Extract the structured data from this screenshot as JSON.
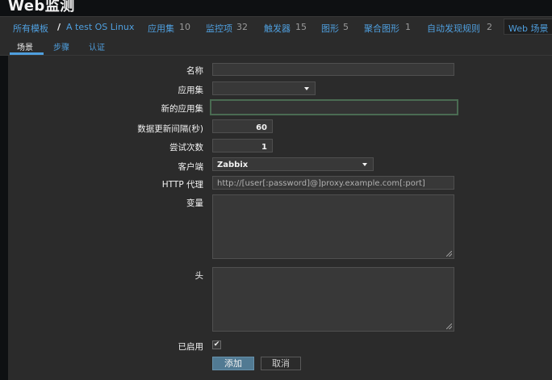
{
  "page": {
    "title": "Web监测"
  },
  "breadcrumb": {
    "all_templates": "所有模板",
    "separator": "/",
    "template_name": "A test OS Linux",
    "items": [
      {
        "label": "应用集",
        "count": "10"
      },
      {
        "label": "监控项",
        "count": "32"
      },
      {
        "label": "触发器",
        "count": "15"
      },
      {
        "label": "图形",
        "count": "5"
      },
      {
        "label": "聚合图形",
        "count": "1"
      },
      {
        "label": "自动发现规则",
        "count": "2"
      }
    ],
    "active": "Web 场景"
  },
  "tabs": [
    {
      "label": "场景",
      "active": true
    },
    {
      "label": "步骤",
      "active": false
    },
    {
      "label": "认证",
      "active": false
    }
  ],
  "form": {
    "name": {
      "label": "名称",
      "value": ""
    },
    "application": {
      "label": "应用集",
      "value": ""
    },
    "new_application": {
      "label": "新的应用集",
      "value": ""
    },
    "update_interval": {
      "label": "数据更新间隔(秒)",
      "value": "60"
    },
    "attempts": {
      "label": "尝试次数",
      "value": "1"
    },
    "agent": {
      "label": "客户端",
      "value": "Zabbix"
    },
    "http_proxy": {
      "label": "HTTP 代理",
      "placeholder": "http://[user[:password]@]proxy.example.com[:port]"
    },
    "variables": {
      "label": "变量",
      "value": ""
    },
    "headers": {
      "label": "头",
      "value": ""
    },
    "enabled": {
      "label": "已启用",
      "checked": true
    }
  },
  "buttons": {
    "add": "添加",
    "cancel": "取消"
  },
  "colors": {
    "accent": "#4f9fde",
    "panel": "#2b2b2b",
    "primary_button": "#517a93"
  }
}
